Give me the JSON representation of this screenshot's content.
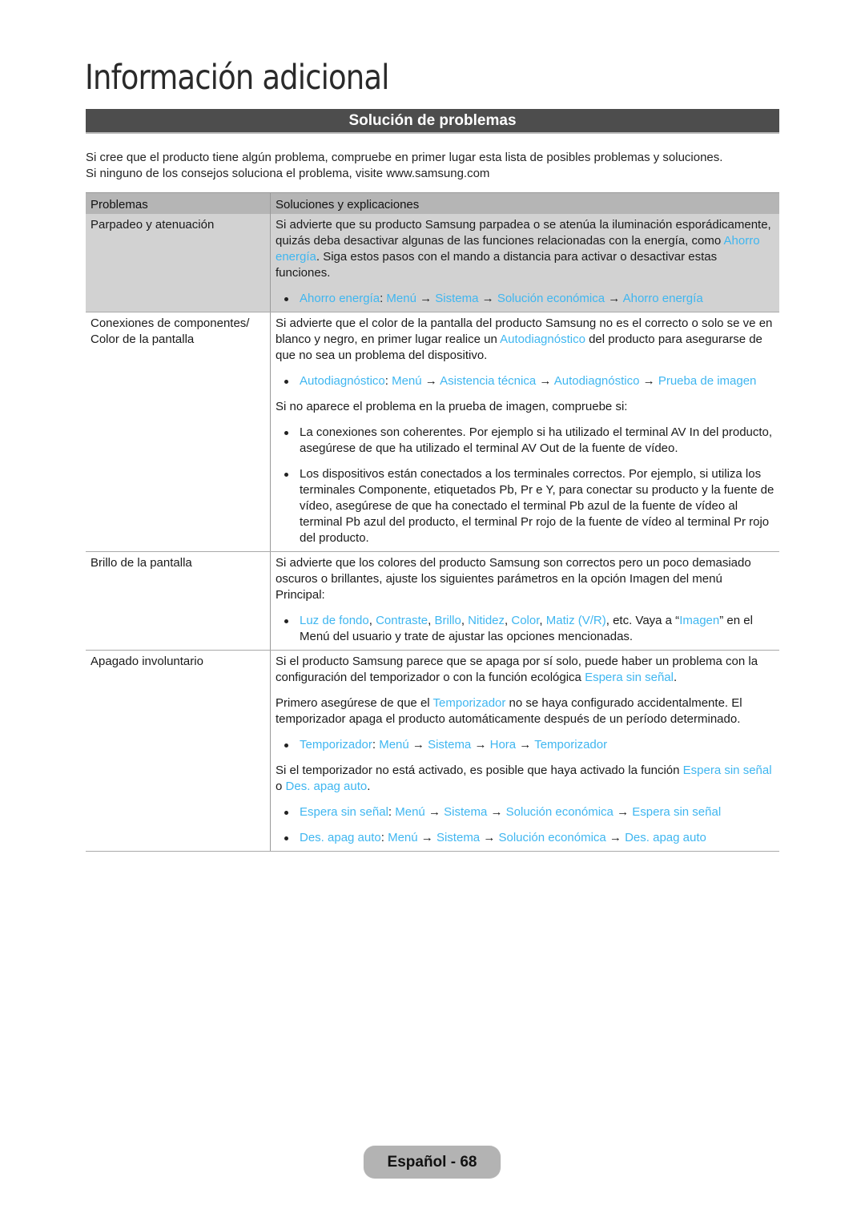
{
  "page_title": "Información adicional",
  "section_title": "Solución de problemas",
  "intro": [
    "Si cree que el producto tiene algún problema, compruebe en primer lugar esta lista de posibles problemas y soluciones.",
    "Si ninguno de los consejos soluciona el problema, visite www.samsung.com"
  ],
  "table": {
    "headers": [
      "Problemas",
      "Soluciones y explicaciones"
    ],
    "rows": [
      {
        "problem": "Parpadeo y atenuación",
        "shaded": true,
        "blocks": [
          {
            "type": "p",
            "segments": [
              {
                "t": "Si advierte que su producto Samsung parpadea o se atenúa la iluminación esporádicamente, quizás deba desactivar algunas de las funciones relacionadas con la energía, como "
              },
              {
                "t": "Ahorro energía",
                "link": true
              },
              {
                "t": ".  Siga estos pasos con el mando a distancia para activar o desactivar estas funciones."
              }
            ]
          },
          {
            "type": "li",
            "segments": [
              {
                "t": "Ahorro energía",
                "link": true
              },
              {
                "t": ": "
              },
              {
                "t": "Menú",
                "link": true
              },
              {
                "t": " → "
              },
              {
                "t": "Sistema",
                "link": true
              },
              {
                "t": " → "
              },
              {
                "t": "Solución económica",
                "link": true
              },
              {
                "t": " → "
              },
              {
                "t": "Ahorro energía",
                "link": true
              }
            ]
          }
        ]
      },
      {
        "problem": "Conexiones de componentes/ Color de la pantalla",
        "shaded": false,
        "blocks": [
          {
            "type": "p",
            "segments": [
              {
                "t": "Si advierte que el color de la pantalla del producto Samsung no es el correcto o solo se ve en blanco y negro, en primer lugar realice un "
              },
              {
                "t": "Autodiagnóstico",
                "link": true
              },
              {
                "t": " del producto para asegurarse de que no sea un problema del dispositivo."
              }
            ]
          },
          {
            "type": "li",
            "segments": [
              {
                "t": "Autodiagnóstico",
                "link": true
              },
              {
                "t": ": "
              },
              {
                "t": "Menú",
                "link": true
              },
              {
                "t": " → "
              },
              {
                "t": "Asistencia técnica",
                "link": true
              },
              {
                "t": " → "
              },
              {
                "t": "Autodiagnóstico",
                "link": true
              },
              {
                "t": " → "
              },
              {
                "t": "Prueba de imagen",
                "link": true
              }
            ]
          },
          {
            "type": "p",
            "segments": [
              {
                "t": "Si no aparece el problema en la prueba de imagen, compruebe si:"
              }
            ]
          },
          {
            "type": "li",
            "segments": [
              {
                "t": "La conexiones son coherentes. Por ejemplo si ha utilizado el terminal AV In del producto, asegúrese de que ha utilizado el terminal AV Out de la fuente de vídeo."
              }
            ]
          },
          {
            "type": "li",
            "segments": [
              {
                "t": "Los dispositivos están conectados a los terminales correctos. Por ejemplo, si utiliza los terminales Componente, etiquetados Pb, Pr e Y, para conectar su producto y la fuente de vídeo, asegúrese de que ha conectado el terminal Pb azul de la fuente de vídeo al terminal Pb azul del producto, el terminal Pr rojo de la fuente de vídeo al terminal Pr rojo del producto."
              }
            ]
          }
        ]
      },
      {
        "problem": "Brillo de la pantalla",
        "shaded": false,
        "blocks": [
          {
            "type": "p",
            "segments": [
              {
                "t": "Si advierte que los colores del producto Samsung son correctos pero un poco demasiado oscuros o brillantes, ajuste los siguientes parámetros en la opción Imagen del menú Principal:"
              }
            ]
          },
          {
            "type": "li",
            "segments": [
              {
                "t": "Luz de fondo",
                "link": true
              },
              {
                "t": ", "
              },
              {
                "t": "Contraste",
                "link": true
              },
              {
                "t": ", "
              },
              {
                "t": "Brillo",
                "link": true
              },
              {
                "t": ", "
              },
              {
                "t": "Nitidez",
                "link": true
              },
              {
                "t": ", "
              },
              {
                "t": "Color",
                "link": true
              },
              {
                "t": ", "
              },
              {
                "t": "Matiz (V/R)",
                "link": true
              },
              {
                "t": ", etc. Vaya a “"
              },
              {
                "t": "Imagen",
                "link": true
              },
              {
                "t": "” en el Menú del usuario y trate de ajustar las opciones mencionadas."
              }
            ]
          }
        ]
      },
      {
        "problem": "Apagado involuntario",
        "shaded": false,
        "blocks": [
          {
            "type": "p",
            "segments": [
              {
                "t": "Si el producto Samsung parece que se apaga por sí solo, puede haber un problema con la configuración del temporizador o con la función ecológica "
              },
              {
                "t": "Espera sin señal",
                "link": true
              },
              {
                "t": "."
              }
            ]
          },
          {
            "type": "p",
            "segments": [
              {
                "t": "Primero asegúrese de que el "
              },
              {
                "t": "Temporizador",
                "link": true
              },
              {
                "t": " no se haya configurado accidentalmente. El temporizador apaga el producto automáticamente después de un período determinado."
              }
            ]
          },
          {
            "type": "li",
            "segments": [
              {
                "t": "Temporizador",
                "link": true
              },
              {
                "t": ": "
              },
              {
                "t": "Menú",
                "link": true
              },
              {
                "t": " → "
              },
              {
                "t": "Sistema",
                "link": true
              },
              {
                "t": " → "
              },
              {
                "t": "Hora",
                "link": true
              },
              {
                "t": " → "
              },
              {
                "t": "Temporizador",
                "link": true
              }
            ]
          },
          {
            "type": "p",
            "segments": [
              {
                "t": "Si el temporizador no está activado, es posible que haya activado la función "
              },
              {
                "t": "Espera sin señal",
                "link": true
              },
              {
                "t": " o "
              },
              {
                "t": "Des. apag auto",
                "link": true
              },
              {
                "t": "."
              }
            ]
          },
          {
            "type": "li",
            "segments": [
              {
                "t": "Espera sin señal",
                "link": true
              },
              {
                "t": ": "
              },
              {
                "t": "Menú",
                "link": true
              },
              {
                "t": " → "
              },
              {
                "t": "Sistema",
                "link": true
              },
              {
                "t": " → "
              },
              {
                "t": "Solución económica",
                "link": true
              },
              {
                "t": " → "
              },
              {
                "t": "Espera sin señal",
                "link": true
              }
            ]
          },
          {
            "type": "li",
            "segments": [
              {
                "t": "Des. apag auto",
                "link": true
              },
              {
                "t": ": "
              },
              {
                "t": "Menú",
                "link": true
              },
              {
                "t": " → "
              },
              {
                "t": "Sistema",
                "link": true
              },
              {
                "t": " → "
              },
              {
                "t": "Solución económica",
                "link": true
              },
              {
                "t": " → "
              },
              {
                "t": "Des. apag auto",
                "link": true
              }
            ]
          }
        ]
      }
    ]
  },
  "footer": {
    "page_label": "Español - 68"
  },
  "colors": {
    "link": "#3fb6f0",
    "section_bar": "#4d4d4d",
    "table_header": "#b5b5b5",
    "shaded_row": "#d2d2d2",
    "footer_pill": "#b3b3b3"
  }
}
